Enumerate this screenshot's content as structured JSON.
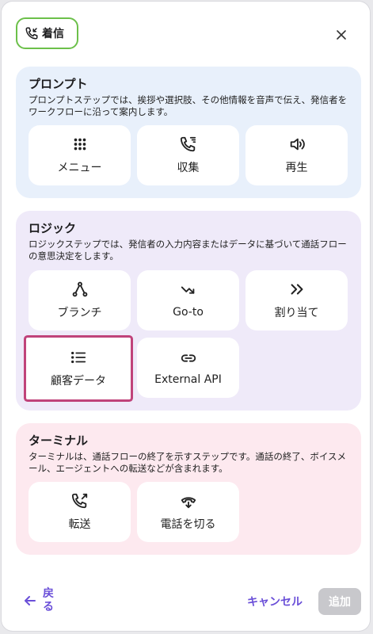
{
  "header": {
    "tag_label": "着信",
    "tag_icon": "incoming-call-icon",
    "close_icon": "close-icon"
  },
  "sections": {
    "prompt": {
      "title": "プロンプト",
      "description": "プロンプトステップでは、挨拶や選択肢、その他情報を音声で伝え、発信者をワークフローに沿って案内します。",
      "cards": [
        {
          "label": "メニュー",
          "icon": "menu-grid-icon"
        },
        {
          "label": "収集",
          "icon": "collect-call-icon"
        },
        {
          "label": "再生",
          "icon": "speaker-icon"
        }
      ]
    },
    "logic": {
      "title": "ロジック",
      "description": "ロジックステップでは、発信者の入力内容またはデータに基づいて通話フローの意思決定をします。",
      "cards": [
        {
          "label": "ブランチ",
          "icon": "branch-icon"
        },
        {
          "label": "Go-to",
          "icon": "goto-icon"
        },
        {
          "label": "割り当て",
          "icon": "assign-icon"
        },
        {
          "label": "顧客データ",
          "icon": "list-icon",
          "selected": true
        },
        {
          "label": "External API",
          "icon": "link-icon"
        }
      ]
    },
    "terminal": {
      "title": "ターミナル",
      "description": "ターミナルは、通話フローの終了を示すステップです。通話の終了、ボイスメール、エージェントへの転送などが含まれます。",
      "cards": [
        {
          "label": "転送",
          "icon": "transfer-call-icon"
        },
        {
          "label": "電話を切る",
          "icon": "hang-up-icon"
        }
      ]
    }
  },
  "footer": {
    "back_label": "戻る",
    "cancel_label": "キャンセル",
    "add_label": "追加"
  },
  "colors": {
    "accent": "#6a4fd8",
    "tag_border": "#6cc04a",
    "selected_border": "#c0437a"
  }
}
